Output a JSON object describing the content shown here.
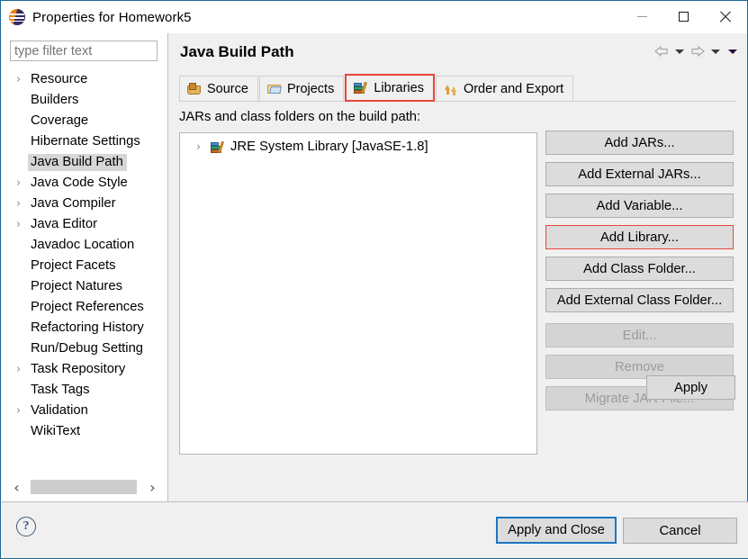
{
  "window": {
    "title": "Properties for Homework5",
    "icon": "eclipse-icon",
    "controls": {
      "minimize": "minimize-button",
      "maximize": "maximize-button",
      "close": "close-button"
    }
  },
  "sidebar": {
    "filter": {
      "value": "",
      "placeholder": "type filter text"
    },
    "items": [
      {
        "label": "Resource",
        "expandable": true,
        "selected": false
      },
      {
        "label": "Builders",
        "expandable": false,
        "selected": false
      },
      {
        "label": "Coverage",
        "expandable": false,
        "selected": false
      },
      {
        "label": "Hibernate Settings",
        "expandable": false,
        "selected": false
      },
      {
        "label": "Java Build Path",
        "expandable": false,
        "selected": true
      },
      {
        "label": "Java Code Style",
        "expandable": true,
        "selected": false
      },
      {
        "label": "Java Compiler",
        "expandable": true,
        "selected": false
      },
      {
        "label": "Java Editor",
        "expandable": true,
        "selected": false
      },
      {
        "label": "Javadoc Location",
        "expandable": false,
        "selected": false
      },
      {
        "label": "Project Facets",
        "expandable": false,
        "selected": false
      },
      {
        "label": "Project Natures",
        "expandable": false,
        "selected": false
      },
      {
        "label": "Project References",
        "expandable": false,
        "selected": false
      },
      {
        "label": "Refactoring History",
        "expandable": false,
        "selected": false
      },
      {
        "label": "Run/Debug Setting",
        "expandable": false,
        "selected": false
      },
      {
        "label": "Task Repository",
        "expandable": true,
        "selected": false
      },
      {
        "label": "Task Tags",
        "expandable": false,
        "selected": false
      },
      {
        "label": "Validation",
        "expandable": true,
        "selected": false
      },
      {
        "label": "WikiText",
        "expandable": false,
        "selected": false
      }
    ],
    "scrollbar": {
      "left_arrow": "‹",
      "right_arrow": "›"
    },
    "arrow_glyph": "›"
  },
  "page": {
    "title": "Java Build Path",
    "nav": {
      "back": "back-arrow",
      "forward": "forward-arrow",
      "menu": "dropdown-caret"
    },
    "tabs": [
      {
        "label": "Source",
        "icon": "source-folder-icon",
        "active": false
      },
      {
        "label": "Projects",
        "icon": "projects-folder-icon",
        "active": false
      },
      {
        "label": "Libraries",
        "icon": "libraries-books-icon",
        "active": true
      },
      {
        "label": "Order and Export",
        "icon": "order-export-arrows-icon",
        "active": false
      }
    ],
    "section_label": "JARs and class folders on the build path:",
    "library_list": [
      {
        "label": "JRE System Library [JavaSE-1.8]",
        "icon": "libraries-books-icon",
        "expandable": true
      }
    ],
    "buttons": [
      {
        "label": "Add JARs...",
        "state": "enabled",
        "highlighted": false
      },
      {
        "label": "Add External JARs...",
        "state": "enabled",
        "highlighted": false
      },
      {
        "label": "Add Variable...",
        "state": "enabled",
        "highlighted": false
      },
      {
        "label": "Add Library...",
        "state": "enabled",
        "highlighted": true
      },
      {
        "label": "Add Class Folder...",
        "state": "enabled",
        "highlighted": false
      },
      {
        "label": "Add External Class Folder...",
        "state": "enabled",
        "highlighted": false
      },
      {
        "label": "Edit...",
        "state": "disabled",
        "highlighted": false
      },
      {
        "label": "Remove",
        "state": "disabled",
        "highlighted": false
      },
      {
        "label": "Migrate JAR File...",
        "state": "disabled",
        "highlighted": false
      }
    ],
    "apply_label": "Apply"
  },
  "footer": {
    "help": "?",
    "apply_and_close_label": "Apply and Close",
    "cancel_label": "Cancel"
  },
  "colors": {
    "window_border": "#1c6a96",
    "accent_highlight": "#e8443a",
    "default_button_focus": "#1975c4",
    "dialog_bg": "#f0f0f0",
    "selection_bg": "#d6d6d6"
  }
}
